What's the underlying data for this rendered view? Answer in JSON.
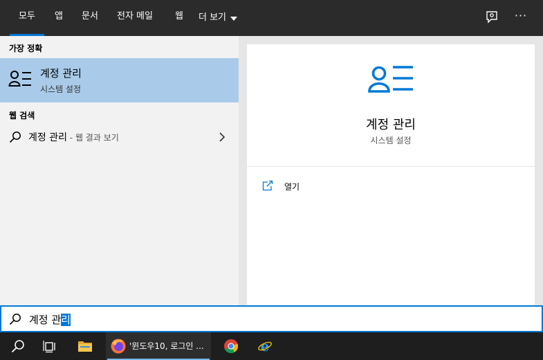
{
  "tabs": [
    {
      "label": "모두",
      "active": true
    },
    {
      "label": "앱"
    },
    {
      "label": "문서"
    },
    {
      "label": "전자 메일"
    },
    {
      "label": "웹"
    },
    {
      "label": "더 보기"
    }
  ],
  "header_icons": {
    "feedback": "feedback-icon",
    "more": "more-options-icon"
  },
  "results": {
    "best_match_heading": "가장 정확",
    "best_match": {
      "title": "계정 관리",
      "subtitle": "시스템 설정",
      "icon": "account-settings-icon"
    },
    "web_heading": "웹 검색",
    "web_item": {
      "query": "계정 관리",
      "suffix": " - 웹 결과 보기",
      "icon": "search-icon"
    }
  },
  "detail": {
    "title": "계정 관리",
    "subtitle": "시스템 설정",
    "action_open": "열기"
  },
  "search": {
    "text_plain": "계정 관",
    "text_selected": "리"
  },
  "taskbar": {
    "firefox_label": "'윈도우10, 로그인 ..."
  },
  "colors": {
    "accent": "#0078d7",
    "selection_bg": "#a9cbe9",
    "tabbar_bg": "#2b2b2b",
    "taskbar_bg": "#1e1e1e"
  }
}
